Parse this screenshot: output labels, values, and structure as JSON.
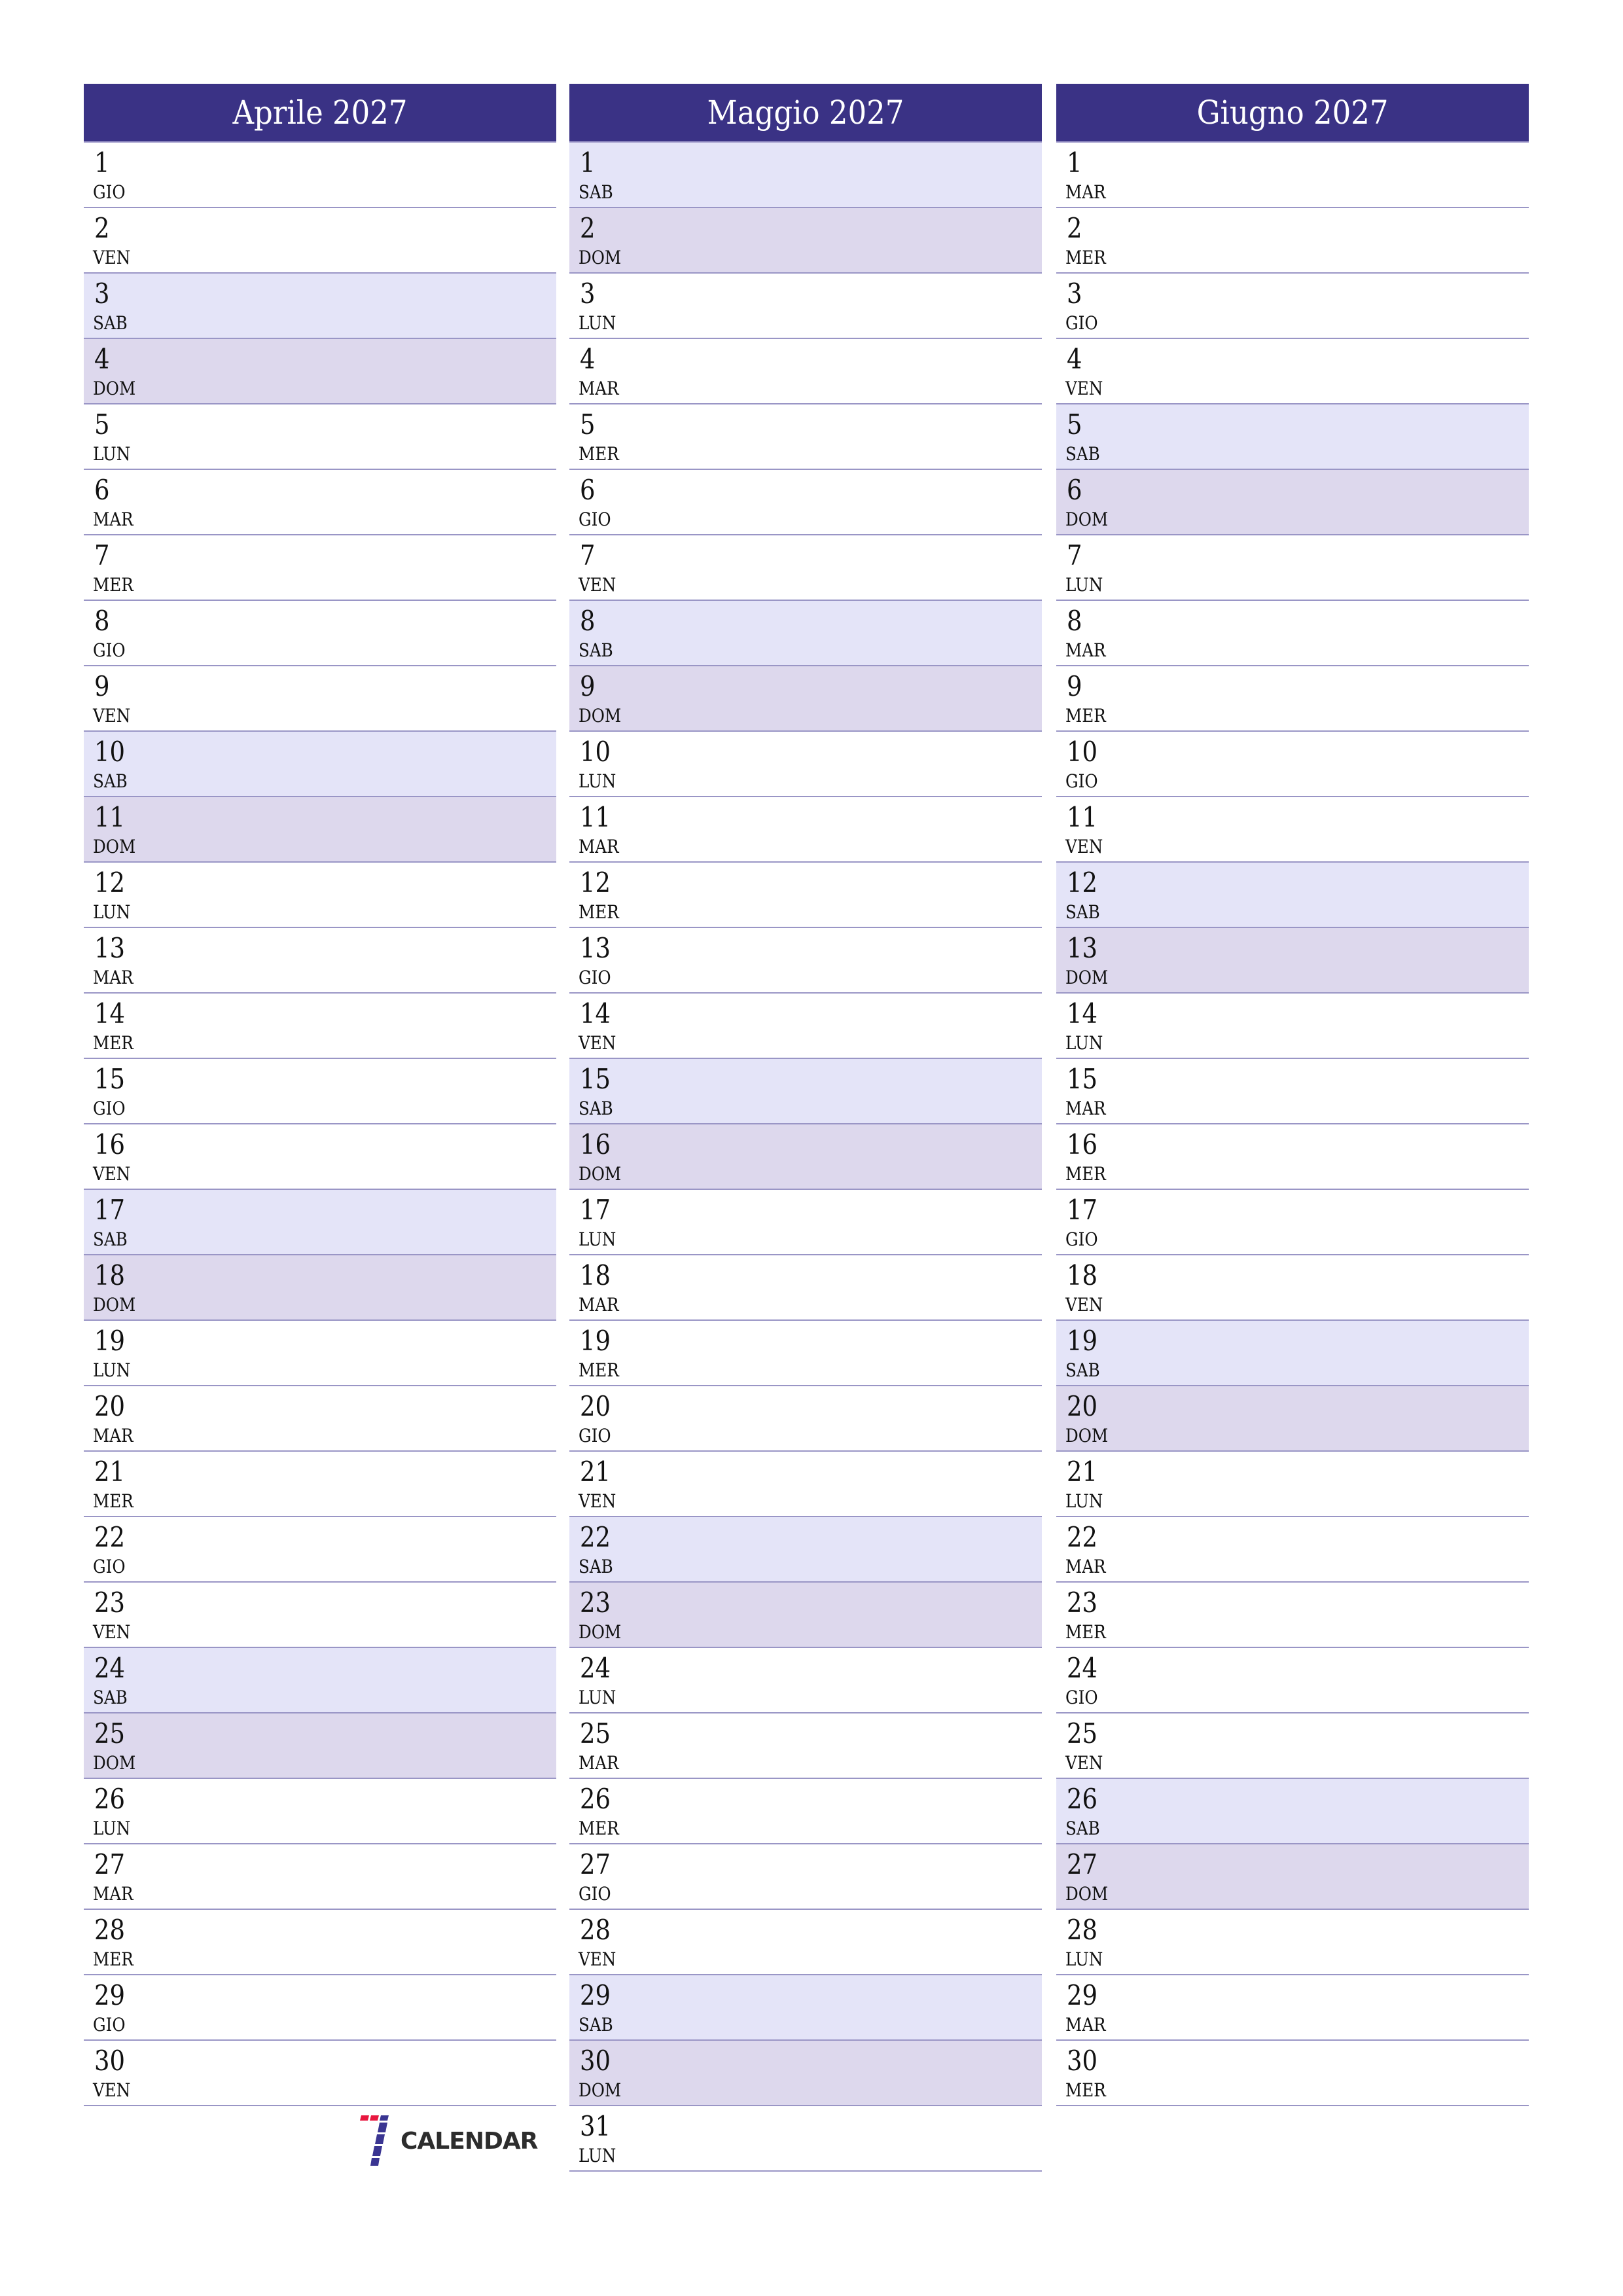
{
  "months": [
    {
      "title": "Aprile 2027",
      "days": [
        {
          "n": "1",
          "d": "GIO"
        },
        {
          "n": "2",
          "d": "VEN"
        },
        {
          "n": "3",
          "d": "SAB"
        },
        {
          "n": "4",
          "d": "DOM"
        },
        {
          "n": "5",
          "d": "LUN"
        },
        {
          "n": "6",
          "d": "MAR"
        },
        {
          "n": "7",
          "d": "MER"
        },
        {
          "n": "8",
          "d": "GIO"
        },
        {
          "n": "9",
          "d": "VEN"
        },
        {
          "n": "10",
          "d": "SAB"
        },
        {
          "n": "11",
          "d": "DOM"
        },
        {
          "n": "12",
          "d": "LUN"
        },
        {
          "n": "13",
          "d": "MAR"
        },
        {
          "n": "14",
          "d": "MER"
        },
        {
          "n": "15",
          "d": "GIO"
        },
        {
          "n": "16",
          "d": "VEN"
        },
        {
          "n": "17",
          "d": "SAB"
        },
        {
          "n": "18",
          "d": "DOM"
        },
        {
          "n": "19",
          "d": "LUN"
        },
        {
          "n": "20",
          "d": "MAR"
        },
        {
          "n": "21",
          "d": "MER"
        },
        {
          "n": "22",
          "d": "GIO"
        },
        {
          "n": "23",
          "d": "VEN"
        },
        {
          "n": "24",
          "d": "SAB"
        },
        {
          "n": "25",
          "d": "DOM"
        },
        {
          "n": "26",
          "d": "LUN"
        },
        {
          "n": "27",
          "d": "MAR"
        },
        {
          "n": "28",
          "d": "MER"
        },
        {
          "n": "29",
          "d": "GIO"
        },
        {
          "n": "30",
          "d": "VEN"
        }
      ]
    },
    {
      "title": "Maggio 2027",
      "days": [
        {
          "n": "1",
          "d": "SAB"
        },
        {
          "n": "2",
          "d": "DOM"
        },
        {
          "n": "3",
          "d": "LUN"
        },
        {
          "n": "4",
          "d": "MAR"
        },
        {
          "n": "5",
          "d": "MER"
        },
        {
          "n": "6",
          "d": "GIO"
        },
        {
          "n": "7",
          "d": "VEN"
        },
        {
          "n": "8",
          "d": "SAB"
        },
        {
          "n": "9",
          "d": "DOM"
        },
        {
          "n": "10",
          "d": "LUN"
        },
        {
          "n": "11",
          "d": "MAR"
        },
        {
          "n": "12",
          "d": "MER"
        },
        {
          "n": "13",
          "d": "GIO"
        },
        {
          "n": "14",
          "d": "VEN"
        },
        {
          "n": "15",
          "d": "SAB"
        },
        {
          "n": "16",
          "d": "DOM"
        },
        {
          "n": "17",
          "d": "LUN"
        },
        {
          "n": "18",
          "d": "MAR"
        },
        {
          "n": "19",
          "d": "MER"
        },
        {
          "n": "20",
          "d": "GIO"
        },
        {
          "n": "21",
          "d": "VEN"
        },
        {
          "n": "22",
          "d": "SAB"
        },
        {
          "n": "23",
          "d": "DOM"
        },
        {
          "n": "24",
          "d": "LUN"
        },
        {
          "n": "25",
          "d": "MAR"
        },
        {
          "n": "26",
          "d": "MER"
        },
        {
          "n": "27",
          "d": "GIO"
        },
        {
          "n": "28",
          "d": "VEN"
        },
        {
          "n": "29",
          "d": "SAB"
        },
        {
          "n": "30",
          "d": "DOM"
        },
        {
          "n": "31",
          "d": "LUN"
        }
      ]
    },
    {
      "title": "Giugno 2027",
      "days": [
        {
          "n": "1",
          "d": "MAR"
        },
        {
          "n": "2",
          "d": "MER"
        },
        {
          "n": "3",
          "d": "GIO"
        },
        {
          "n": "4",
          "d": "VEN"
        },
        {
          "n": "5",
          "d": "SAB"
        },
        {
          "n": "6",
          "d": "DOM"
        },
        {
          "n": "7",
          "d": "LUN"
        },
        {
          "n": "8",
          "d": "MAR"
        },
        {
          "n": "9",
          "d": "MER"
        },
        {
          "n": "10",
          "d": "GIO"
        },
        {
          "n": "11",
          "d": "VEN"
        },
        {
          "n": "12",
          "d": "SAB"
        },
        {
          "n": "13",
          "d": "DOM"
        },
        {
          "n": "14",
          "d": "LUN"
        },
        {
          "n": "15",
          "d": "MAR"
        },
        {
          "n": "16",
          "d": "MER"
        },
        {
          "n": "17",
          "d": "GIO"
        },
        {
          "n": "18",
          "d": "VEN"
        },
        {
          "n": "19",
          "d": "SAB"
        },
        {
          "n": "20",
          "d": "DOM"
        },
        {
          "n": "21",
          "d": "LUN"
        },
        {
          "n": "22",
          "d": "MAR"
        },
        {
          "n": "23",
          "d": "MER"
        },
        {
          "n": "24",
          "d": "GIO"
        },
        {
          "n": "25",
          "d": "VEN"
        },
        {
          "n": "26",
          "d": "SAB"
        },
        {
          "n": "27",
          "d": "DOM"
        },
        {
          "n": "28",
          "d": "LUN"
        },
        {
          "n": "29",
          "d": "MAR"
        },
        {
          "n": "30",
          "d": "MER"
        }
      ]
    }
  ],
  "weekend": {
    "saturday": "SAB",
    "sunday": "DOM"
  },
  "colors": {
    "header": "#3a3285",
    "saturday": "#e4e4f8",
    "sunday": "#ddd8ed",
    "divider": "#9a96c6",
    "logo_red": "#e8173f",
    "logo_blue": "#3a3592"
  },
  "logo": {
    "text": "CALENDAR",
    "icon": "seven-calendar-logo-icon"
  }
}
